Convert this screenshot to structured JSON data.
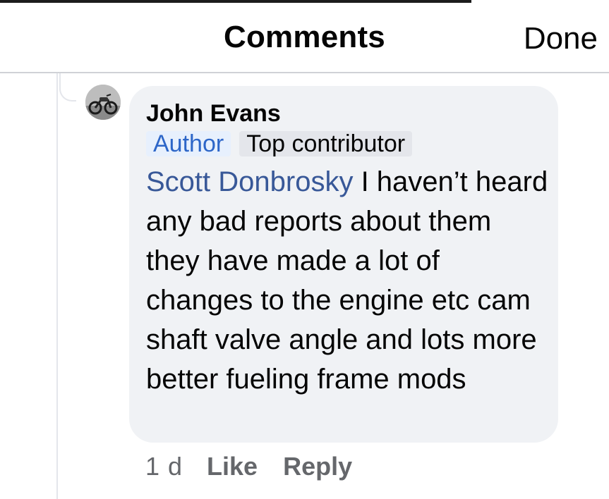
{
  "header": {
    "title": "Comments",
    "done_label": "Done"
  },
  "comment": {
    "author": "John Evans",
    "badges": [
      "Author",
      "Top contributor"
    ],
    "mention": "Scott Donbrosky",
    "text": " I haven’t heard any bad reports about them they have made a lot of changes to the engine etc cam shaft valve angle and lots more better fueling frame mods",
    "timestamp": "1 d",
    "actions": {
      "like_label": "Like",
      "reply_label": "Reply"
    }
  },
  "icons": {
    "avatar": "motorcycle-photo-avatar"
  },
  "colors": {
    "bubble_bg": "#f0f2f5",
    "mention": "#385898",
    "author_badge_bg": "#e7f0fd",
    "author_badge_text": "#2d66c8",
    "meta_text": "#65676b"
  }
}
